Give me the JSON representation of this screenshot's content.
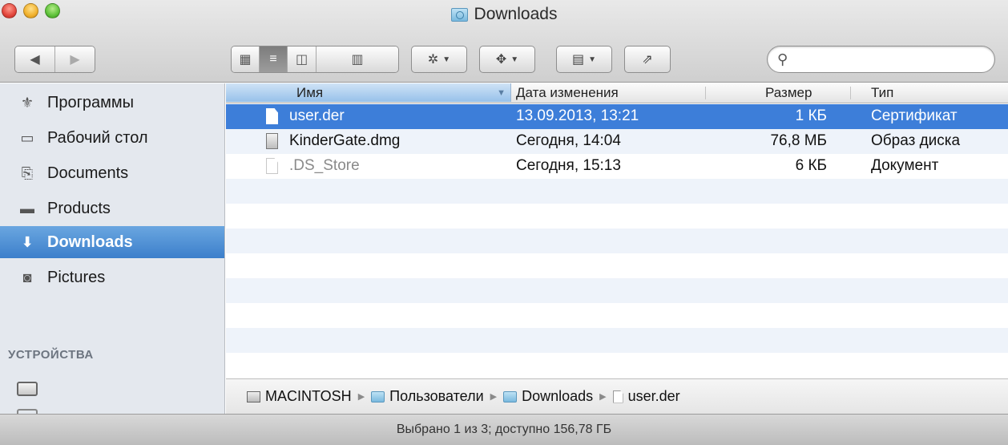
{
  "window": {
    "title": "Downloads"
  },
  "toolbar": {
    "back_icon": "back-arrow-icon",
    "forward_icon": "forward-arrow-icon",
    "views": [
      {
        "name": "icon-view",
        "glyph": "▦",
        "active": false
      },
      {
        "name": "list-view",
        "glyph": "≡",
        "active": true
      },
      {
        "name": "column-view",
        "glyph": "◫",
        "active": false
      },
      {
        "name": "coverflow-view",
        "glyph": "▥",
        "active": false
      }
    ],
    "action_icon": "gear-icon",
    "dropbox_icon": "dropbox-icon",
    "arrange_icon": "arrange-icon",
    "share_icon": "share-icon",
    "search": {
      "placeholder": "",
      "value": ""
    }
  },
  "sidebar": {
    "items": [
      {
        "label": "Программы",
        "icon": "applications-icon",
        "selected": false
      },
      {
        "label": "Рабочий стол",
        "icon": "desktop-icon",
        "selected": false
      },
      {
        "label": "Documents",
        "icon": "documents-icon",
        "selected": false
      },
      {
        "label": "Products",
        "icon": "folder-icon",
        "selected": false
      },
      {
        "label": "Downloads",
        "icon": "downloads-icon",
        "selected": true
      },
      {
        "label": "Pictures",
        "icon": "pictures-icon",
        "selected": false
      }
    ],
    "devices_header": "УСТРОЙСТВА"
  },
  "columns": {
    "name": "Имя",
    "date": "Дата изменения",
    "size": "Размер",
    "type": "Тип"
  },
  "files": [
    {
      "name": "user.der",
      "date": "13.09.2013, 13:21",
      "size": "1 КБ",
      "type": "Сертификат",
      "selected": true,
      "dim": false
    },
    {
      "name": "KinderGate.dmg",
      "date": "Сегодня, 14:04",
      "size": "76,8 МБ",
      "type": "Образ диска",
      "selected": false,
      "dim": false
    },
    {
      "name": ".DS_Store",
      "date": "Сегодня, 15:13",
      "size": "6 КБ",
      "type": "Документ",
      "selected": false,
      "dim": true
    }
  ],
  "pathbar": [
    "MACINTOSH",
    "Пользователи",
    "Downloads",
    "user.der"
  ],
  "status": "Выбрано 1 из 3; доступно 156,78 ГБ",
  "colors": {
    "selection": "#3d7ed9",
    "sidebar_bg": "#e4e8ee"
  }
}
